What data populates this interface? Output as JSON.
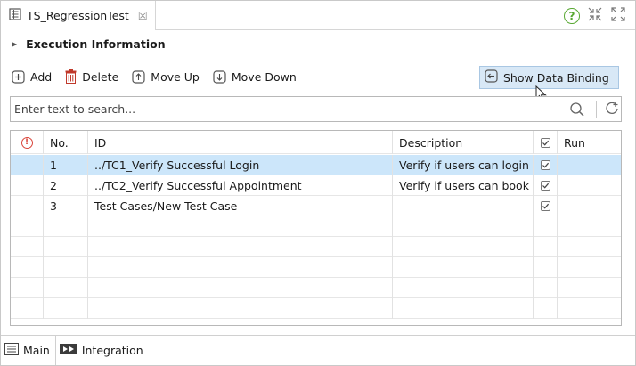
{
  "editor_tab": {
    "title": "TS_RegressionTest",
    "close_glyph": "☒"
  },
  "section": {
    "label": "Execution Information"
  },
  "toolbar": {
    "add": "Add",
    "delete": "Delete",
    "move_up": "Move Up",
    "move_down": "Move Down",
    "show_data_binding": "Show Data Binding"
  },
  "search": {
    "placeholder": "Enter text to search..."
  },
  "table": {
    "columns": {
      "warn": "",
      "no": "No.",
      "id": "ID",
      "description": "Description",
      "run": "Run"
    },
    "rows": [
      {
        "no": "1",
        "id": "../TC1_Verify Successful Login",
        "description": "Verify if users can login",
        "run": true,
        "selected": true
      },
      {
        "no": "2",
        "id": "../TC2_Verify Successful Appointment",
        "description": "Verify if users can book",
        "run": true,
        "selected": false
      },
      {
        "no": "3",
        "id": "Test Cases/New Test Case",
        "description": "",
        "run": true,
        "selected": false
      }
    ],
    "empty_rows": 5
  },
  "bottom_tabs": {
    "main": "Main",
    "integration": "Integration"
  },
  "colors": {
    "selection": "#cce6fa",
    "binding_button": "#d8e8f6",
    "warn": "#d9463c",
    "help": "#58a832",
    "delete_icon": "#c0392b"
  }
}
